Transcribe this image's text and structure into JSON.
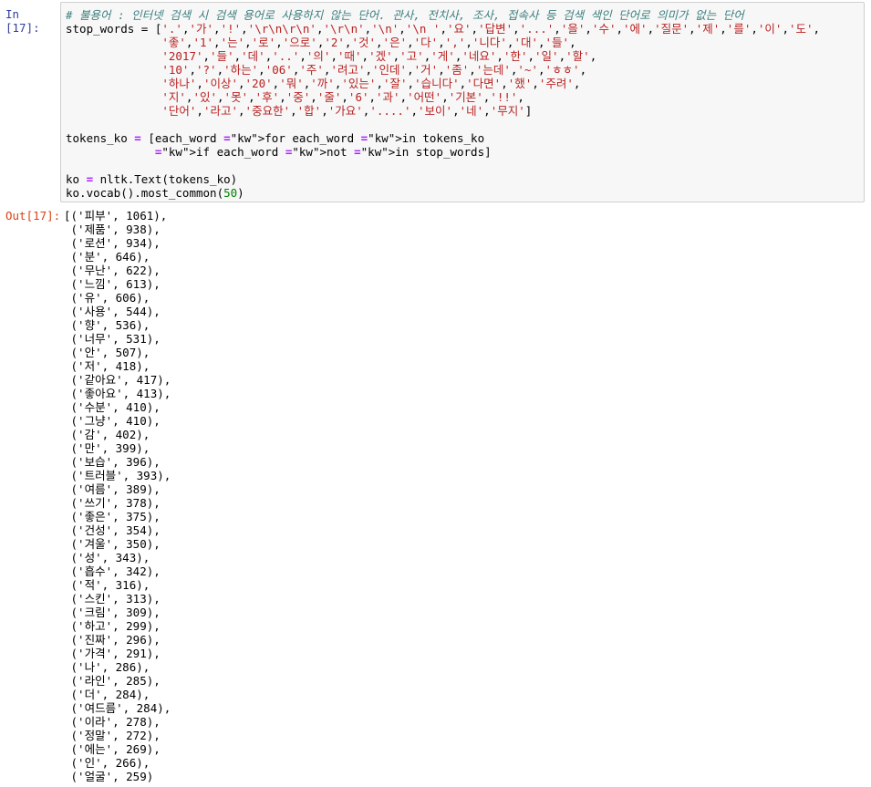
{
  "input_cell": {
    "prompt": "In [17]:",
    "comment": "# 불용어 : 인터넷 검색 시 검색 용어로 사용하지 않는 단어. 관사, 전치사, 조사, 접속사 등 검색 색인 단어로 의미가 없는 단어",
    "stop_words_lines": [
      "stop_words = ['.','가','!','\\r\\n\\r\\n','\\r\\n','\\n','\\n ','요','답변','...','을','수','에','질문','제','를','이','도',",
      "              '좋','1','는','로','으로','2','것','은','다',',','니다','대','들',",
      "              '2017','들','데','..','의','때','겠','고','게','네요','한','일','할',",
      "              '10','?','하는','06','주','려고','인데','거','좀','는데','~','ㅎㅎ',",
      "              '하나','이상','20','뭐','까','있는','잘','습니다','다면','했','주려',",
      "              '지','있','못','후','중','줄','6','과','어떤','기본','!!',",
      "              '단어','라고','중요한','합','가요','....','보이','네','무지']"
    ],
    "tokens_line1": "tokens_ko = [each_word for each_word in tokens_ko",
    "tokens_line2": "             if each_word not in stop_words]",
    "text_line": "ko = nltk.Text(tokens_ko)",
    "vocab_line": "ko.vocab().most_common(50)"
  },
  "output_cell": {
    "prompt": "Out[17]:",
    "lines": [
      "[('피부', 1061),",
      " ('제품', 938),",
      " ('로션', 934),",
      " ('분', 646),",
      " ('무난', 622),",
      " ('느낌', 613),",
      " ('유', 606),",
      " ('사용', 544),",
      " ('향', 536),",
      " ('너무', 531),",
      " ('안', 507),",
      " ('저', 418),",
      " ('같아요', 417),",
      " ('좋아요', 413),",
      " ('수분', 410),",
      " ('그냥', 410),",
      " ('감', 402),",
      " ('만', 399),",
      " ('보습', 396),",
      " ('트러블', 393),",
      " ('여름', 389),",
      " ('쓰기', 378),",
      " ('좋은', 375),",
      " ('건성', 354),",
      " ('겨울', 350),",
      " ('성', 343),",
      " ('흡수', 342),",
      " ('적', 316),",
      " ('스킨', 313),",
      " ('크림', 309),",
      " ('하고', 299),",
      " ('진짜', 296),",
      " ('가격', 291),",
      " ('나', 286),",
      " ('라인', 285),",
      " ('더', 284),",
      " ('여드름', 284),",
      " ('이라', 278),",
      " ('정말', 272),",
      " ('에는', 269),",
      " ('인', 266),",
      " ('얼굴', 259)"
    ]
  }
}
